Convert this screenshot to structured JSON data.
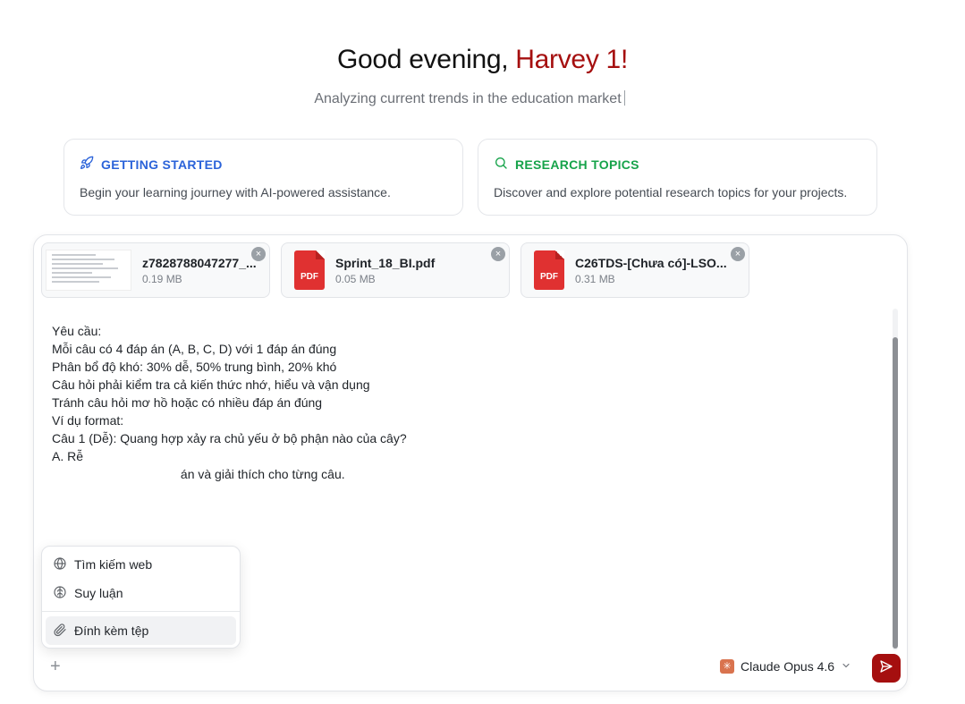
{
  "header": {
    "greeting_prefix": "Good evening, ",
    "greeting_name": "Harvey 1!",
    "subtitle": "Analyzing current trends in the education market"
  },
  "cards": [
    {
      "title": "GETTING STARTED",
      "description": "Begin your learning journey with AI-powered assistance.",
      "icon": "rocket-icon",
      "color": "#2b63d9"
    },
    {
      "title": "RESEARCH TOPICS",
      "description": "Discover and explore potential research topics for your projects.",
      "icon": "search-icon",
      "color": "#16a34a"
    }
  ],
  "attachments": [
    {
      "name": "z7828788047277_...",
      "size": "0.19 MB",
      "type": "image"
    },
    {
      "name": "Sprint_18_BI.pdf",
      "size": "0.05 MB",
      "type": "pdf",
      "badge": "PDF"
    },
    {
      "name": "C26TDS-[Chưa có]-LSO...",
      "size": "0.31 MB",
      "type": "pdf",
      "badge": "PDF"
    }
  ],
  "message_lines": [
    "Yêu cầu:",
    "",
    "Mỗi câu có 4 đáp án (A, B, C, D) với 1 đáp án đúng",
    "",
    "Phân bổ độ khó: 30% dễ, 50% trung bình, 20% khó",
    "",
    "Câu hỏi phải kiểm tra cả kiến thức nhớ, hiểu và vận dụng",
    "",
    "Tránh câu hỏi mơ hồ hoặc có nhiều đáp án đúng",
    "",
    "Ví dụ format:",
    "Câu 1 (Dễ): Quang hợp xảy ra chủ yếu ở bộ phận nào của cây?",
    "A. Rễ",
    "",
    "",
    "",
    "",
    "                                     án và giải thích cho từng câu."
  ],
  "menu": {
    "items": [
      {
        "label": "Tìm kiếm web",
        "icon": "globe-icon"
      },
      {
        "label": "Suy luận",
        "icon": "brain-icon"
      },
      {
        "label": "Đính kèm tệp",
        "icon": "paperclip-icon"
      }
    ]
  },
  "footer": {
    "model_name": "Claude Opus 4.6",
    "accent": "#a50f0f"
  }
}
